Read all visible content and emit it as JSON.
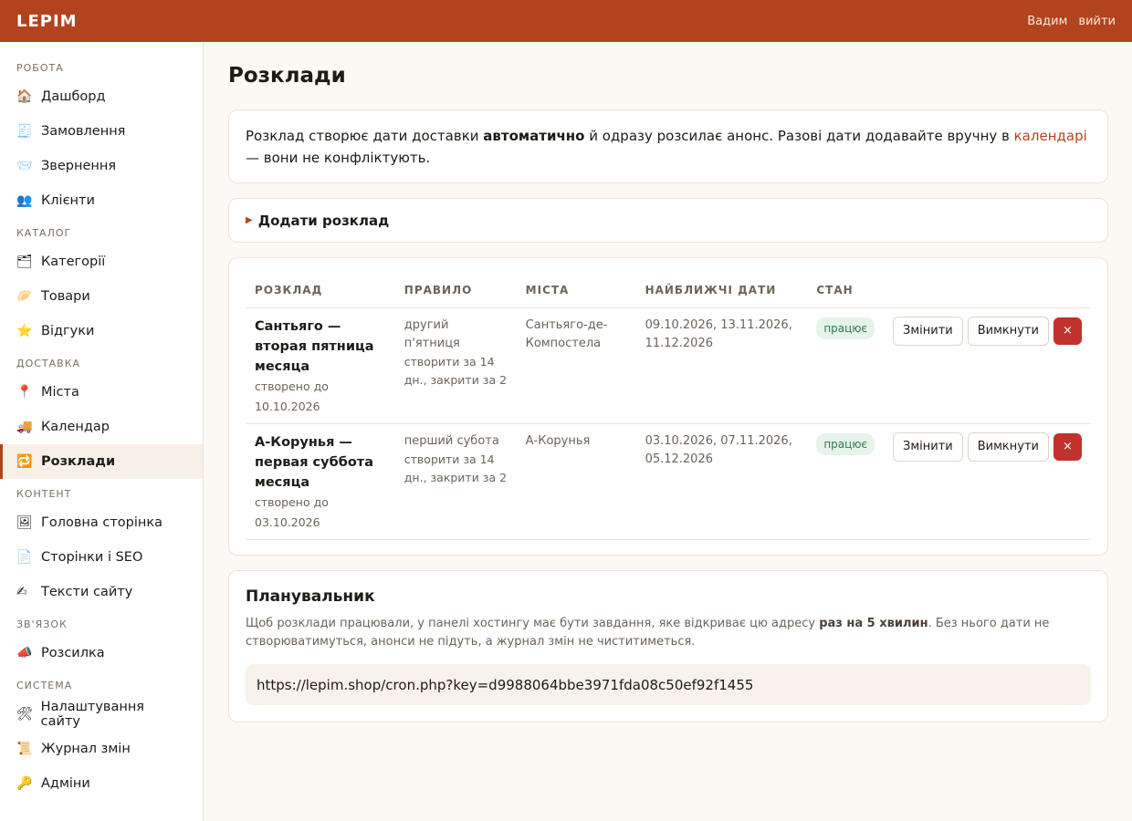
{
  "header": {
    "logo": "LEPIM",
    "user": "Вадим",
    "logout": "вийти"
  },
  "sidebar": {
    "groups": [
      {
        "title": "РОБОТА",
        "items": [
          {
            "icon": "🏠",
            "label": "Дашборд"
          },
          {
            "icon": "🧾",
            "label": "Замовлення"
          },
          {
            "icon": "📨",
            "label": "Звернення"
          },
          {
            "icon": "👥",
            "label": "Клієнти"
          }
        ]
      },
      {
        "title": "КАТАЛОГ",
        "items": [
          {
            "icon": "🗂",
            "label": "Категорії"
          },
          {
            "icon": "🥟",
            "label": "Товари"
          },
          {
            "icon": "⭐",
            "label": "Відгуки"
          }
        ]
      },
      {
        "title": "ДОСТАВКА",
        "items": [
          {
            "icon": "📍",
            "label": "Міста"
          },
          {
            "icon": "🚚",
            "label": "Календар"
          },
          {
            "icon": "🔁",
            "label": "Розклади"
          }
        ]
      },
      {
        "title": "КОНТЕНТ",
        "items": [
          {
            "icon": "🖼",
            "label": "Головна сторінка"
          },
          {
            "icon": "📄",
            "label": "Сторінки і SEO"
          },
          {
            "icon": "✍",
            "label": "Тексти сайту"
          }
        ]
      },
      {
        "title": "ЗВ'ЯЗОК",
        "items": [
          {
            "icon": "📣",
            "label": "Розсилка"
          }
        ]
      },
      {
        "title": "СИСТЕМА",
        "items": [
          {
            "icon": "🛠",
            "label": "Налаштування сайту"
          },
          {
            "icon": "📜",
            "label": "Журнал змін"
          },
          {
            "icon": "🔑",
            "label": "Адміни"
          }
        ]
      }
    ],
    "active": "Розклади"
  },
  "page": {
    "title": "Розклади"
  },
  "info": {
    "part1": "Розклад створює дати доставки ",
    "bold": "автоматично",
    "part2": " й одразу розсилає анонс. Разові дати додавайте вручну в ",
    "link": "календарі",
    "part3": " — вони не конфліктують."
  },
  "add_schedule": {
    "label": "Додати розклад"
  },
  "table": {
    "headers": [
      "РОЗКЛАД",
      "ПРАВИЛО",
      "МІСТА",
      "НАЙБЛИЖЧІ ДАТИ",
      "СТАН"
    ],
    "rows": [
      {
        "name": "Сантьяго — вторая пятница месяца",
        "created": "створено до 10.10.2026",
        "rule": "другий п'ятниця",
        "rule_sub": "створити за 14 дн., закрити за 2",
        "city": "Сантьяго-де-Компостела",
        "dates": "09.10.2026, 13.11.2026, 11.12.2026",
        "status": "працює",
        "edit": "Змінити",
        "disable": "Вимкнути",
        "delete": "×"
      },
      {
        "name": "А-Корунья — первая суббота месяца",
        "created": "створено до 03.10.2026",
        "rule": "перший субота",
        "rule_sub": "створити за 14 дн., закрити за 2",
        "city": "А-Корунья",
        "dates": "03.10.2026, 07.11.2026, 05.12.2026",
        "status": "працює",
        "edit": "Змінити",
        "disable": "Вимкнути",
        "delete": "×"
      }
    ]
  },
  "planner": {
    "title": "Планувальник",
    "text1": "Щоб розклади працювали, у панелі хостингу має бути завдання, яке відкриває цю адресу ",
    "bold": "раз на 5 хвилин",
    "text2": ". Без нього дати не створюватимуться, анонси не підуть, а журнал змін не чиститиметься.",
    "url": "https://lepim.shop/cron.php?key=d9988064bbe3971fda08c50ef92f1455"
  }
}
